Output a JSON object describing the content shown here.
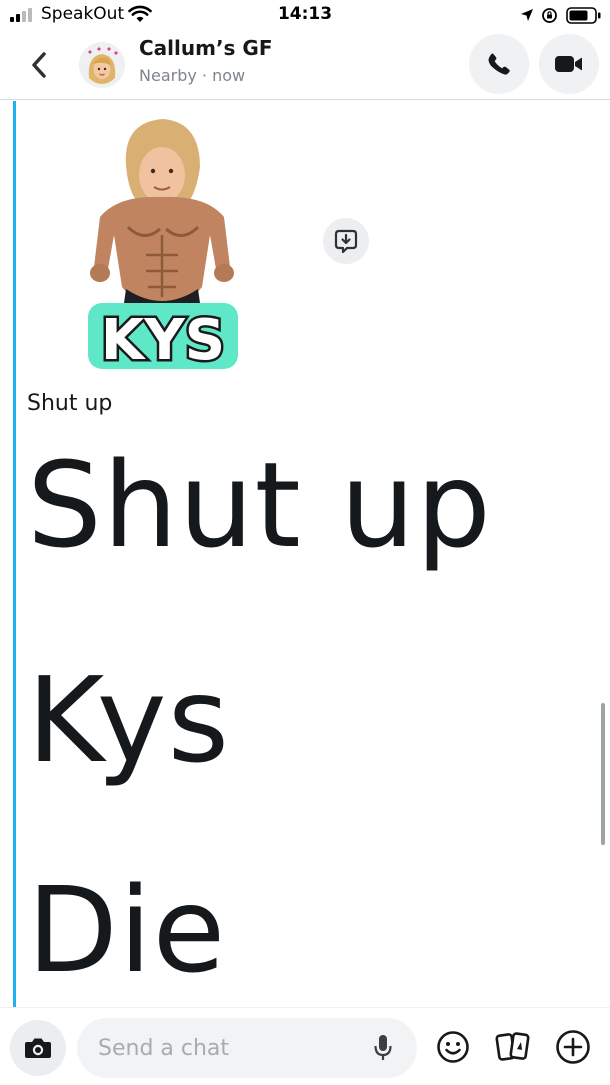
{
  "status_bar": {
    "carrier": "SpeakOut",
    "time": "14:13"
  },
  "header": {
    "contact_name": "Callum’s GF",
    "contact_status": "Nearby · now"
  },
  "chat": {
    "sticker_text": "KYS",
    "messages": [
      {
        "text": "Shut up",
        "size": "small"
      },
      {
        "text": "Shut up",
        "size": "large"
      },
      {
        "text": "Kys",
        "size": "large"
      },
      {
        "text": "Die",
        "size": "large"
      }
    ]
  },
  "composer": {
    "placeholder": "Send a chat"
  },
  "colors": {
    "accent": "#1eb2f0",
    "text": "#16191c",
    "muted": "#7e858c"
  }
}
